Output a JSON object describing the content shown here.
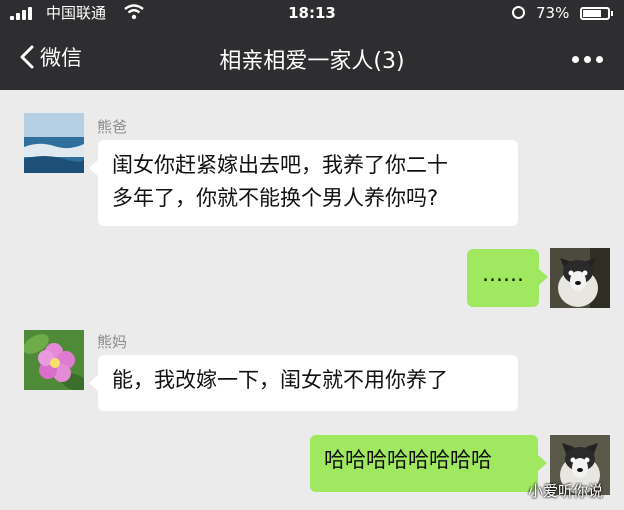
{
  "status_bar": {
    "carrier": "中国联通",
    "time": "18:13",
    "battery_percent": "73%",
    "battery_level": 0.73,
    "icons": [
      "signal-icon",
      "wifi-icon",
      "rotation-lock-icon",
      "battery-icon"
    ]
  },
  "nav": {
    "back_label": "微信",
    "title": "相亲相爱一家人(3)",
    "more_icon": "more-dots-icon"
  },
  "messages": [
    {
      "side": "left",
      "sender": "熊爸",
      "lines": [
        "闺女你赶紧嫁出去吧，我养了你二十",
        "多年了，你就不能换个男人养你吗?"
      ]
    },
    {
      "side": "right",
      "lines": [
        "……"
      ]
    },
    {
      "side": "left",
      "sender": "熊妈",
      "lines": [
        "能，我改嫁一下，闺女就不用你养了"
      ]
    },
    {
      "side": "right",
      "lines": [
        "哈哈哈哈哈哈哈哈"
      ]
    }
  ],
  "watermark": "小爱听你说",
  "colors": {
    "header_bg": "#2e2e30",
    "chat_bg": "#ebebeb",
    "bubble_self": "#9fe85f",
    "bubble_other": "#ffffff"
  }
}
